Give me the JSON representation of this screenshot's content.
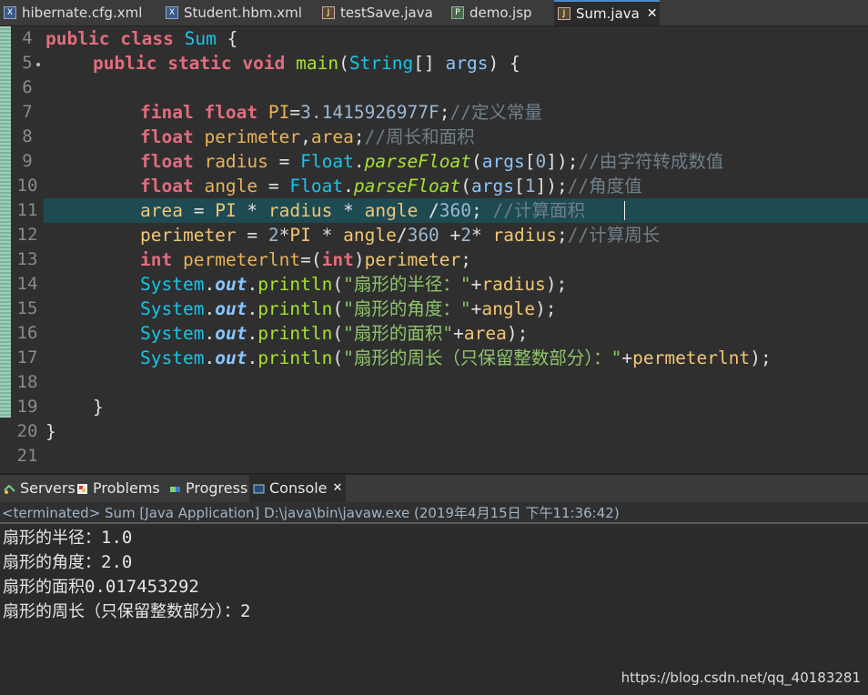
{
  "tabs": [
    {
      "label": "hibernate.cfg.xml",
      "icon": "xml-file-icon",
      "active": false
    },
    {
      "label": "Student.hbm.xml",
      "icon": "xml-file-icon",
      "active": false
    },
    {
      "label": "testSave.java",
      "icon": "java-file-icon",
      "active": false
    },
    {
      "label": "demo.jsp",
      "icon": "jsp-file-icon",
      "active": false
    },
    {
      "label": "Sum.java",
      "icon": "java-file-icon",
      "active": true
    }
  ],
  "editor": {
    "line_numbers": [
      "4",
      "5",
      "6",
      "7",
      "8",
      "9",
      "10",
      "11",
      "12",
      "13",
      "14",
      "15",
      "16",
      "17",
      "18",
      "19",
      "20",
      "21"
    ],
    "current_line": "11",
    "code": {
      "l4": [
        "public",
        " ",
        "class",
        " ",
        "Sum",
        " {"
      ],
      "l5": [
        "public",
        " ",
        "static",
        " ",
        "void",
        " ",
        "main",
        "(",
        "String",
        "[] ",
        "args",
        ") {"
      ],
      "l7": [
        "final",
        " ",
        "float",
        " ",
        "PI",
        "=",
        "3.1415926977F",
        ";",
        "//定义常量"
      ],
      "l8": [
        "float",
        " ",
        "perimeter",
        ",",
        "area",
        ";",
        "//周长和面积"
      ],
      "l9": [
        "float",
        " ",
        "radius",
        " = ",
        "Float",
        ".",
        "parseFloat",
        "(",
        "args",
        "[",
        "0",
        "]);",
        "//由字符转成数值"
      ],
      "l10": [
        "float",
        " ",
        "angle",
        " = ",
        "Float",
        ".",
        "parseFloat",
        "(",
        "args",
        "[",
        "1",
        "]);",
        "//角度值"
      ],
      "l11": [
        "area",
        " = ",
        "PI",
        " * ",
        "radius",
        " * ",
        "angle",
        " /",
        "360",
        "; ",
        "//计算面积"
      ],
      "l12": [
        "perimeter",
        " = ",
        "2",
        "*",
        "PI",
        " * ",
        "angle",
        "/",
        "360",
        " +",
        "2",
        "* ",
        "radius",
        ";",
        "//计算周长"
      ],
      "l13": [
        "int",
        " ",
        "permeterlnt",
        "=(",
        "int",
        ")",
        "perimeter",
        ";"
      ],
      "l14": [
        "System",
        ".",
        "out",
        ".",
        "println",
        "(",
        "\"扇形的半径：\"",
        "+",
        "radius",
        ");"
      ],
      "l15": [
        "System",
        ".",
        "out",
        ".",
        "println",
        "(",
        "\"扇形的角度：\"",
        "+",
        "angle",
        ");"
      ],
      "l16": [
        "System",
        ".",
        "out",
        ".",
        "println",
        "(",
        "\"扇形的面积\"",
        "+",
        "area",
        ");"
      ],
      "l17": [
        "System",
        ".",
        "out",
        ".",
        "println",
        "(",
        "\"扇形的周长（只保留整数部分）：\"",
        "+",
        "permeterlnt",
        ");"
      ],
      "l19": [
        "}"
      ],
      "l20": [
        "}"
      ]
    }
  },
  "console": {
    "tabs": [
      {
        "label": "Servers",
        "icon": "servers-icon"
      },
      {
        "label": "Problems",
        "icon": "problems-icon"
      },
      {
        "label": "Progress",
        "icon": "progress-icon"
      },
      {
        "label": "Console",
        "icon": "console-icon",
        "active": true
      }
    ],
    "status": "<terminated> Sum [Java Application] D:\\java\\bin\\javaw.exe (2019年4月15日 下午11:36:42)",
    "output": [
      {
        "label": "扇形的半径：",
        "value": "1.0"
      },
      {
        "label": "扇形的角度：",
        "value": "2.0"
      },
      {
        "label": "扇形的面积",
        "value": "0.017453292"
      },
      {
        "label": "扇形的周长（只保留整数部分）：",
        "value": "2"
      }
    ]
  },
  "watermark": "https://blog.csdn.net/qq_40183281",
  "colors": {
    "keyword": "#e26d7d",
    "type": "#19c4e8",
    "method": "#a6e22e",
    "comment": "#6f7f8a",
    "string": "#8fc56b",
    "current_line": "#1e4a52"
  }
}
